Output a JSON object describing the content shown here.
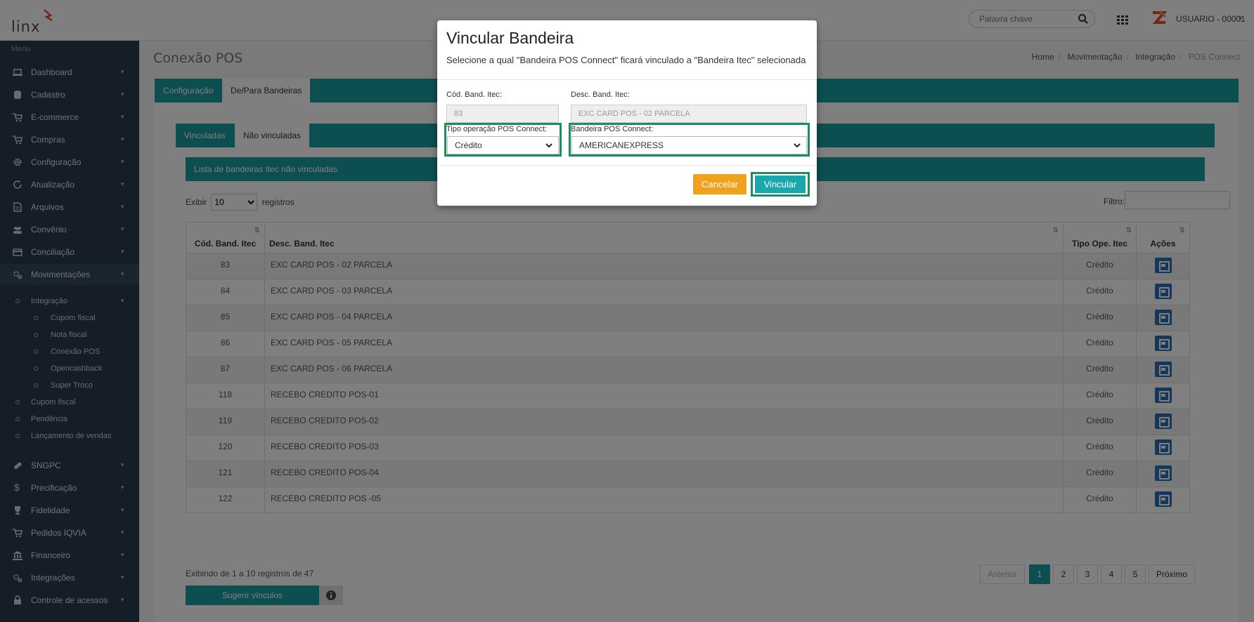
{
  "header": {
    "logo_text": "Linx",
    "search_placeholder": "Palavra chave",
    "user_name": "USUARIO - 00001",
    "accent_color": "#1a9da2"
  },
  "sidebar": {
    "menu_title": "Menu",
    "items": [
      {
        "label": "Dashboard",
        "icon": "laptop-icon"
      },
      {
        "label": "Cadastro",
        "icon": "database-icon"
      },
      {
        "label": "E-commerce",
        "icon": "cart-icon"
      },
      {
        "label": "Compras",
        "icon": "cart-icon"
      },
      {
        "label": "Configuração",
        "icon": "gear-icon"
      },
      {
        "label": "Atualização",
        "icon": "refresh-icon"
      },
      {
        "label": "Arquivos",
        "icon": "file-icon"
      },
      {
        "label": "Convênio",
        "icon": "users-icon"
      },
      {
        "label": "Conciliação",
        "icon": "credit-card-icon"
      },
      {
        "label": "Movimentações",
        "icon": "gears-icon"
      },
      {
        "label": "SNGPC",
        "icon": "pill-icon"
      },
      {
        "label": "Precificação",
        "icon": "dollar-icon"
      },
      {
        "label": "Fidelidade",
        "icon": "trophy-icon"
      },
      {
        "label": "Pedidos IQVIA",
        "icon": "cart-icon"
      },
      {
        "label": "Financeiro",
        "icon": "bank-icon"
      },
      {
        "label": "Integrações",
        "icon": "gears-icon"
      },
      {
        "label": "Controle de acessos",
        "icon": "lock-icon"
      }
    ],
    "subitems": {
      "integracao": "Integração",
      "integracao_children": [
        "Cupom fiscal",
        "Nota fiscal",
        "Conexão POS",
        "Opencashback",
        "Super Troco"
      ],
      "others": [
        "Cupom fiscal",
        "Pendência",
        "Lançamento de vendas"
      ]
    }
  },
  "page": {
    "title": "Conexão POS",
    "breadcrumb": [
      "Home",
      "Movimentação",
      "Integração",
      "POS Connect"
    ],
    "tabs": [
      "Configuração",
      "De/Para Bandeiras"
    ],
    "inner_tabs": [
      "Vinculadas",
      "Não vinculadas"
    ],
    "list_title": "Lista de bandeiras Itec não vinculadas",
    "exibir_label": "Exibir",
    "exibir_value": "10",
    "registros_label": "registros",
    "filtro_label": "Filtro:"
  },
  "table": {
    "headers": [
      "Cód. Band. Itec",
      "Desc. Band. Itec",
      "Tipo Ope. Itec",
      "Ações"
    ],
    "rows": [
      {
        "cod": "83",
        "desc": "EXC CARD POS - 02 PARCELA",
        "tipo": "Crédito"
      },
      {
        "cod": "84",
        "desc": "EXC CARD POS - 03 PARCELA",
        "tipo": "Crédito"
      },
      {
        "cod": "85",
        "desc": "EXC CARD POS - 04 PARCELA",
        "tipo": "Crédito"
      },
      {
        "cod": "86",
        "desc": "EXC CARD POS - 05 PARCELA",
        "tipo": "Crédito"
      },
      {
        "cod": "87",
        "desc": "EXC CARD POS - 06 PARCELA",
        "tipo": "Crédito"
      },
      {
        "cod": "118",
        "desc": "RECEBO CREDITO POS-01",
        "tipo": "Crédito"
      },
      {
        "cod": "119",
        "desc": "RECEBO CREDITO POS-02",
        "tipo": "Crédito"
      },
      {
        "cod": "120",
        "desc": "RECEBO CREDITO POS-03",
        "tipo": "Crédito"
      },
      {
        "cod": "121",
        "desc": "RECEBO CREDITO POS-04",
        "tipo": "Crédito"
      },
      {
        "cod": "122",
        "desc": "RECEBO CREDITO POS -05",
        "tipo": "Crédito"
      }
    ]
  },
  "pagination": {
    "info": "Exibindo de 1 a 10 registros de 47",
    "prev": "Anterior",
    "pages": [
      "1",
      "2",
      "3",
      "4",
      "5"
    ],
    "current": "1",
    "next": "Próximo"
  },
  "footer": {
    "suggest_label": "Sugerir vínculos"
  },
  "modal": {
    "title": "Vincular Bandeira",
    "subtitle": "Selecione a qual \"Bandeira POS Connect\" ficará vinculado a \"Bandeira Itec\" selecionada",
    "cod_label": "Cód. Band. Itec:",
    "cod_value": "83",
    "desc_label": "Desc. Band. Itec:",
    "desc_value": "EXC CARD POS - 02 PARCELA",
    "tipo_label": "Tipo operação POS Connect:",
    "tipo_value": "Crédito",
    "bandeira_label": "Bandeira POS Connect:",
    "bandeira_value": "AMERICANEXPRESS",
    "cancel_label": "Cancelar",
    "confirm_label": "Vincular",
    "cancel_color": "#f0a21c",
    "confirm_color": "#1aa7ad",
    "highlight_color": "#1e8f5c"
  }
}
